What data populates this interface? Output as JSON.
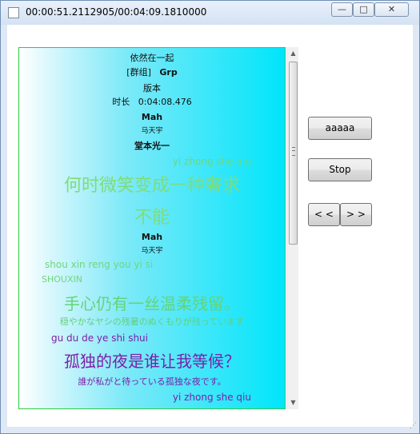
{
  "window": {
    "title": "00:00:51.2112905/00:04:09.1810000",
    "buttons": {
      "minimize": "—",
      "maximize": "□",
      "close": "✕"
    }
  },
  "lyrics": {
    "header": {
      "title": "依然在一起",
      "group": "[群组]",
      "group_name": "Grp",
      "version_label": "版本",
      "duration_label": "时长",
      "duration_value": "0:04:08.476"
    },
    "singer1": {
      "name": "Mah",
      "cn": "马天宇"
    },
    "singer2": {
      "name": "堂本光一"
    },
    "line1_pinyin": "yi zhong she qiu",
    "line1_cn": "何时微笑变成一种奢求",
    "line2_cn": "不能",
    "singer3": {
      "name": "Mah",
      "cn": "马天宇"
    },
    "line3_pinyin": "shou  xin reng you   yi     si",
    "line3_label": "SHOUXIN",
    "line3_cn": "手心仍有一丝温柔残留。",
    "line3_jp": "穏やかなヤシの残暑のぬくもりが残っています",
    "line4_pinyin": "gu   du   de   ye   shi shui",
    "line4_cn": "孤独的夜是谁让我等候？",
    "line4_jp": "誰が私がと待っている孤独な夜です。",
    "line5_pinyin": "yi  zhong she  qiu"
  },
  "controls": {
    "play_label": "aaaaa",
    "stop_label": "Stop",
    "prev_label": "< <",
    "next_label": "> >"
  }
}
